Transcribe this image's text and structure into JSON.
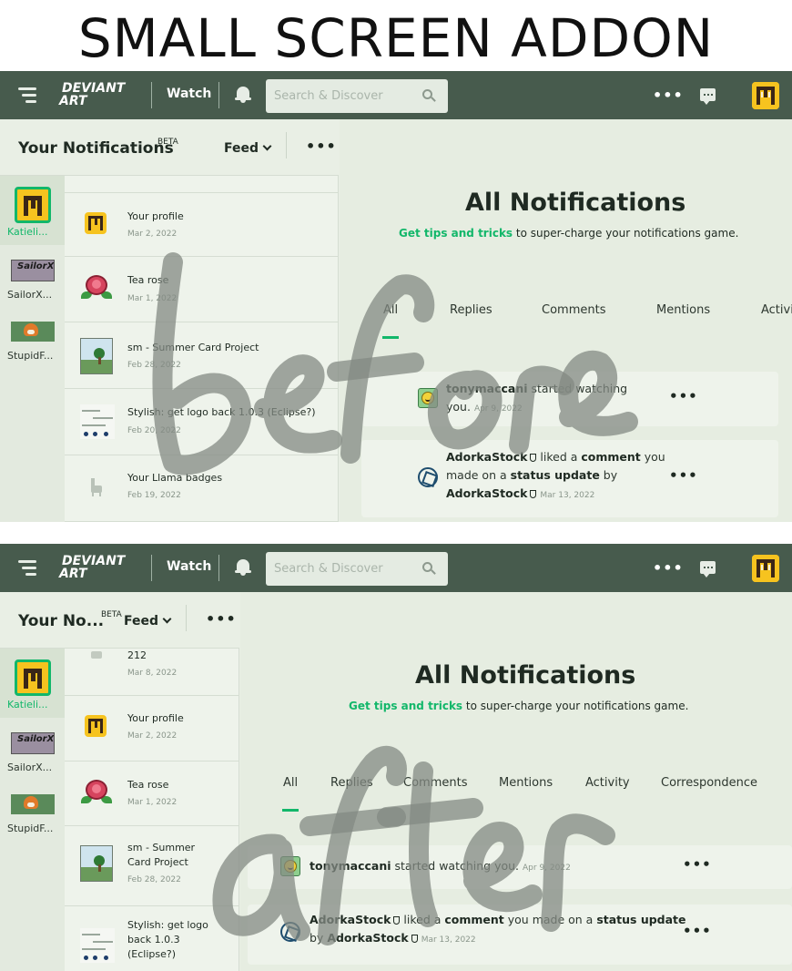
{
  "page_heading": "SMALL SCREEN ADDON",
  "topbar": {
    "logo_line1": "DEVIANT",
    "logo_line2": "ART",
    "watch_label": "Watch",
    "search_placeholder": "Search & Discover",
    "more_label": "•••",
    "icons": [
      "hamburger-icon",
      "bell-icon",
      "search-icon",
      "more-icon",
      "chat-icon",
      "avatar"
    ]
  },
  "left_panel": {
    "title_full": "Your Notifications",
    "title_truncated": "Your No...",
    "beta": "BETA",
    "feed_label": "Feed",
    "more_label": "•••"
  },
  "watch_column": [
    {
      "label": "Katieli..."
    },
    {
      "label": "SailorX..."
    },
    {
      "label": "StupidF..."
    }
  ],
  "thumb_texts": {
    "sailor": "SailorX"
  },
  "before": {
    "list": [
      {
        "title": "Your profile",
        "date": "Mar 2, 2022"
      },
      {
        "title": "Tea rose",
        "date": "Mar 1, 2022"
      },
      {
        "title": "sm - Summer Card Project",
        "date": "Feb 28, 2022"
      },
      {
        "title": "Stylish: get logo back 1.0.3 (Eclipse?)",
        "date": "Feb 20, 2022"
      },
      {
        "title": "Your Llama badges",
        "date": "Feb 19, 2022"
      }
    ],
    "scrawl_label": "before"
  },
  "after": {
    "list": [
      {
        "title": "212",
        "date": "Mar 8, 2022"
      },
      {
        "title": "Your profile",
        "date": "Mar 2, 2022"
      },
      {
        "title": "Tea rose",
        "date": "Mar 1, 2022"
      },
      {
        "title_line1": "sm - Summer",
        "title_line2": "Card Project",
        "date": "Feb 28, 2022"
      },
      {
        "title_line1": "Stylish: get logo",
        "title_line2": "back 1.0.3",
        "title_line3": "(Eclipse?)"
      }
    ],
    "scrawl_label": "after"
  },
  "main": {
    "title": "All Notifications",
    "tips_link": "Get tips and tricks",
    "tips_rest": " to super-charge your notifications game.",
    "tabs_before": [
      "All",
      "Replies",
      "Comments",
      "Mentions",
      "Activi"
    ],
    "tabs_after": [
      "All",
      "Replies",
      "Comments",
      "Mentions",
      "Activity",
      "Correspondence"
    ],
    "notifications": [
      {
        "user": "tonymaccani",
        "text": " started watching",
        "text2": "you.",
        "text_full": " started watching you.",
        "date": "Apr 9, 2022"
      },
      {
        "user": "AdorkaStock",
        "liked": " liked a ",
        "comment": "comment",
        "you_made": " you",
        "made_on": "made on a ",
        "status_update": "status update",
        "by": " by",
        "by_full": "by ",
        "author": "AdorkaStock",
        "you_made_full": " you made on a ",
        "date": "Mar 13, 2022"
      }
    ]
  },
  "colors": {
    "topbar": "#475b4d",
    "accent": "#12b76a",
    "panel_bg": "#e6ede1",
    "avatar": "#f6c31f"
  }
}
